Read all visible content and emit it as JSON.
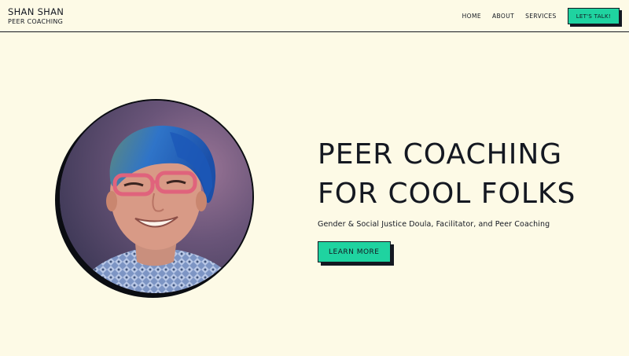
{
  "brand": {
    "name": "SHAN SHAN",
    "tagline": "PEER COACHING"
  },
  "nav": {
    "items": [
      {
        "label": "HOME"
      },
      {
        "label": "ABOUT"
      },
      {
        "label": "SERVICES"
      }
    ],
    "cta_label": "LET'S TALK!"
  },
  "hero": {
    "title_line1": "PEER COACHING",
    "title_line2": "FOR COOL FOLKS",
    "subtitle": "Gender & Social Justice Doula, Facilitator, and Peer Coaching",
    "button_label": "LEARN MORE",
    "portrait_alt": "Portrait of Shan Shan"
  },
  "colors": {
    "background": "#fdfae6",
    "accent": "#1fd3a0",
    "ink": "#141821"
  }
}
